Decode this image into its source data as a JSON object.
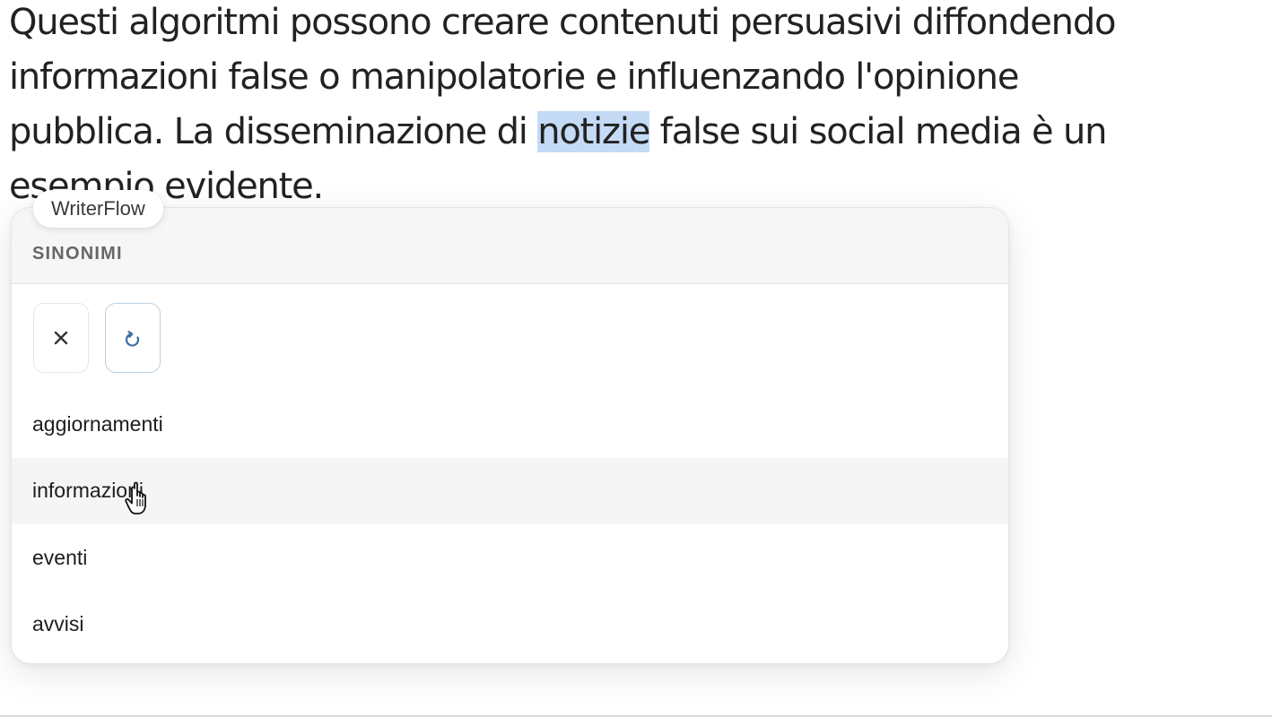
{
  "document": {
    "line1": "Questi algoritmi possono creare contenuti persuasivi diffondendo",
    "line2": "informazioni false o manipolatorie e influenzando l'opinione",
    "line3_before": "pubblica. La disseminazione di ",
    "selected_word": "notizie",
    "line3_after": " false sui social media è un",
    "line4": "esempio evidente."
  },
  "popup": {
    "brand": "WriterFlow",
    "title": "SINONIMI",
    "close_icon": "close-icon",
    "refresh_icon": "refresh-icon",
    "accent_color": "#bcd0e2",
    "synonyms": [
      {
        "label": "aggiornamenti"
      },
      {
        "label": "informazioni"
      },
      {
        "label": "eventi"
      },
      {
        "label": "avvisi"
      }
    ]
  },
  "colors": {
    "selection_highlight": "#c4daf5",
    "hover_row": "#f5f5f5"
  }
}
